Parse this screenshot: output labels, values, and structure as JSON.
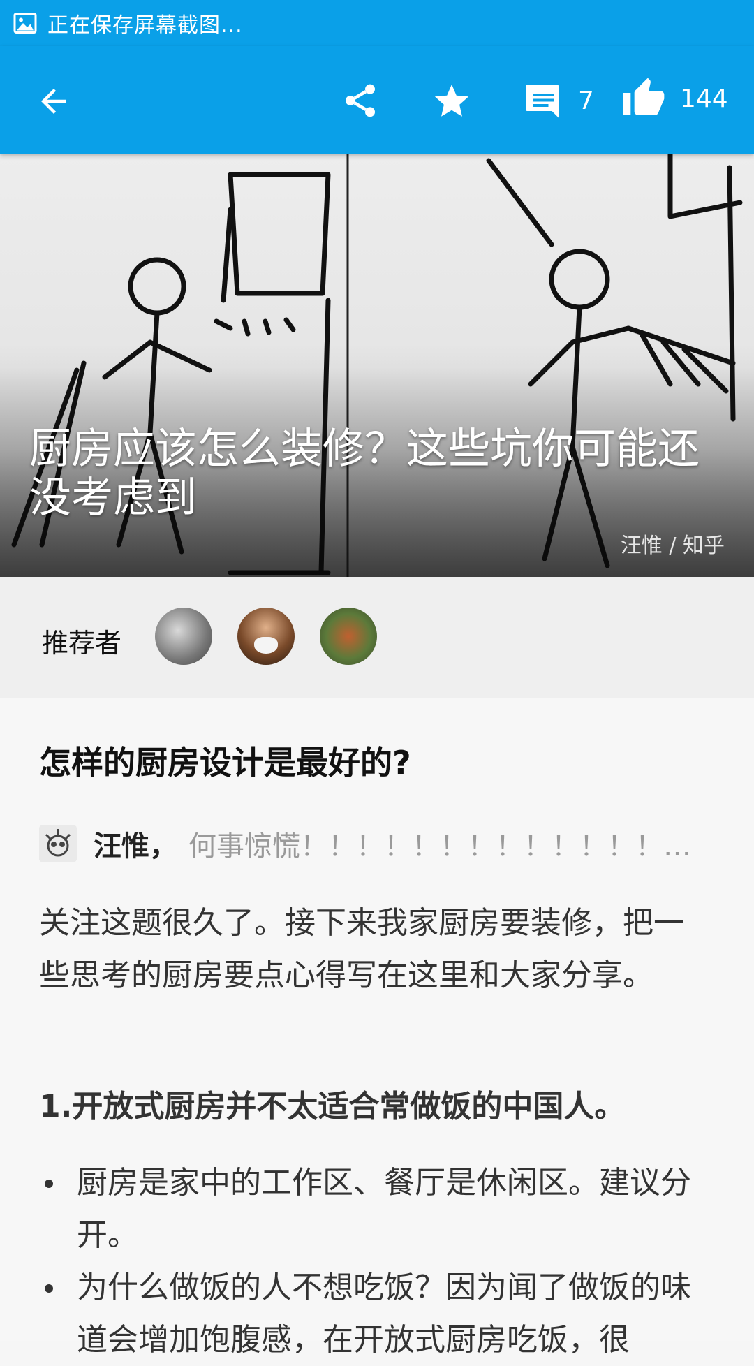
{
  "status_bar": {
    "icon": "image-icon",
    "text": "正在保存屏幕截图..."
  },
  "toolbar": {
    "back_icon": "arrow-back-icon",
    "share_icon": "share-icon",
    "favorite_icon": "star-icon",
    "comment_icon": "comment-icon",
    "comment_count": "7",
    "like_icon": "thumbs-up-icon",
    "like_count": "144",
    "color": "#0aa0e8"
  },
  "hero": {
    "title": "厨房应该怎么装修？这些坑你可能还没考虑到",
    "source": "汪惟 / 知乎"
  },
  "recommenders": {
    "label": "推荐者",
    "count": 3
  },
  "question": {
    "title": "怎样的厨房设计是最好的?"
  },
  "answer": {
    "author_name": "汪惟，",
    "author_bio": "何事惊慌！！！！！！！！！！！！！！！！！！",
    "intro": "关注这题很久了。接下来我家厨房要装修，把一些思考的厨房要点心得写在这里和大家分享。",
    "section_1": "1.开放式厨房并不太适合常做饭的中国人。",
    "bullets": [
      "厨房是家中的工作区、餐厅是休闲区。建议分开。",
      "为什么做饭的人不想吃饭？因为闻了做饭的味道会增加饱腹感，在开放式厨房吃饭，很"
    ]
  }
}
